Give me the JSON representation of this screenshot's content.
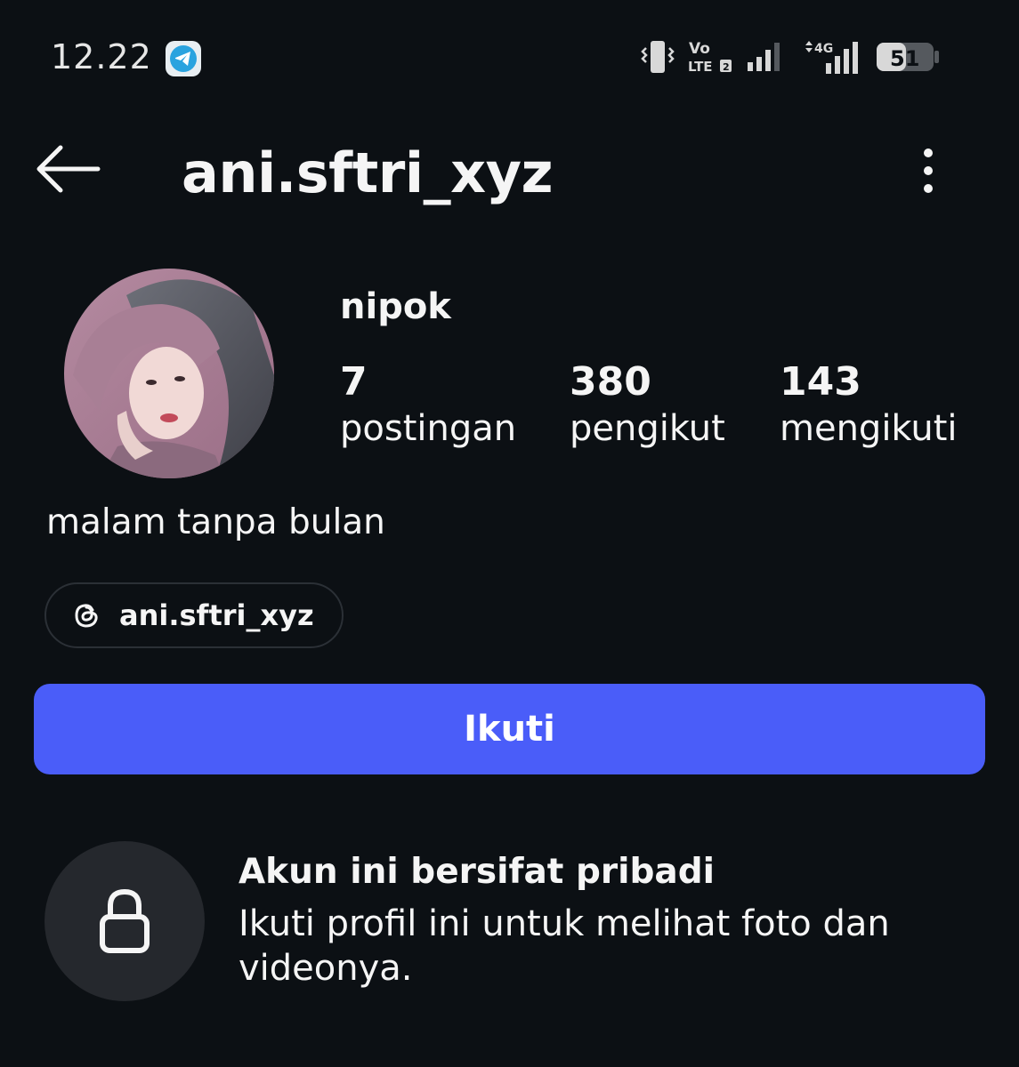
{
  "status_bar": {
    "time": "12.22",
    "volte_top": "Vo",
    "volte_bottom": "LTE",
    "volte_sim": "2",
    "network_type": "4G",
    "battery_level": "51"
  },
  "header": {
    "username": "ani.sftri_xyz"
  },
  "profile": {
    "display_name": "nipok",
    "stats": [
      {
        "count": "7",
        "label": "postingan"
      },
      {
        "count": "380",
        "label": "pengikut"
      },
      {
        "count": "143",
        "label": "mengikuti"
      }
    ],
    "bio": "malam tanpa bulan",
    "threads_handle": "ani.sftri_xyz"
  },
  "actions": {
    "follow_label": "Ikuti"
  },
  "private_notice": {
    "title": "Akun ini bersifat pribadi",
    "description": "Ikuti profil ini untuk melihat foto dan videonya."
  },
  "colors": {
    "background": "#0c1014",
    "follow_button": "#4a5df9",
    "lock_circle": "#25282d"
  },
  "icons": [
    "telegram-icon",
    "vibrate-icon",
    "signal-icon",
    "battery-icon",
    "back-arrow-icon",
    "more-vertical-icon",
    "threads-icon",
    "lock-icon"
  ]
}
